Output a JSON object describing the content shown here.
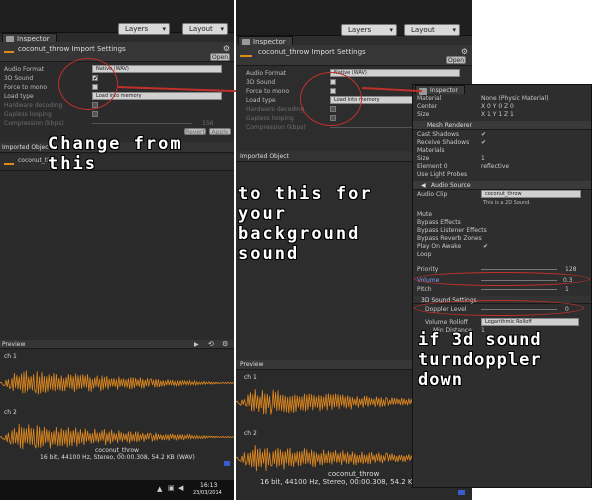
{
  "top_bar": {
    "layers_label": "Layers",
    "layout_label": "Layout",
    "layers_label_2": "Layers",
    "layout_label_2": "Layout"
  },
  "left_panel": {
    "tab": "Inspector",
    "header_title": "coconut_throw Import Settings",
    "open_button": "Open",
    "rows": [
      {
        "label": "Audio Format",
        "value": "Native (WAV)",
        "kind": "dropdown"
      },
      {
        "label": "3D Sound",
        "value": "✔",
        "kind": "check"
      },
      {
        "label": "Force to mono",
        "value": "",
        "kind": "check"
      },
      {
        "label": "Load type",
        "value": "Load into memory",
        "kind": "dropdown"
      },
      {
        "label": "Hardware decoding",
        "value": "",
        "kind": "check_dim"
      },
      {
        "label": "Gapless looping",
        "value": "",
        "kind": "check_dim"
      },
      {
        "label": "Compression (kbps)",
        "value": "156",
        "kind": "slider_dim"
      }
    ],
    "revert_button": "Revert",
    "apply_button": "Apply",
    "imported_object_label": "Imported Objec",
    "imported_object_name": "coconut_th",
    "preview_label": "Preview",
    "ch1": "ch 1",
    "ch2": "ch 2",
    "clip_name": "coconut_throw",
    "clip_info": "16 bit, 44100 Hz, Stereo, 00:00.308, 54.2 KB (WAV)"
  },
  "middle_panel": {
    "tab": "Inspector",
    "header_title": "coconut_throw Import Settings",
    "open_button": "Open",
    "rows": [
      {
        "label": "Audio Format",
        "value": "Native (WAV)",
        "kind": "dropdown"
      },
      {
        "label": "3D Sound",
        "value": "",
        "kind": "check"
      },
      {
        "label": "Force to mono",
        "value": "",
        "kind": "check"
      },
      {
        "label": "Load type",
        "value": "Load into memory",
        "kind": "dropdown"
      },
      {
        "label": "Hardware decoding",
        "value": "",
        "kind": "check_dim"
      },
      {
        "label": "Gapless looping",
        "value": "",
        "kind": "check_dim"
      },
      {
        "label": "Compression (kbps)",
        "value": "",
        "kind": "slider_dim"
      }
    ],
    "imported_object_label": "Imported Object",
    "preview_label": "Preview",
    "ch1": "ch 1",
    "ch2": "ch 2",
    "clip_name": "coconut_throw",
    "clip_info": "16 bit, 44100 Hz, Stereo, 00:00.308, 54.2 KB (WAV)"
  },
  "right_panel": {
    "tab": "Inspector",
    "rows": [
      {
        "label": "Material",
        "value": "None (Physic Material)"
      },
      {
        "label": "Center",
        "value": "X 0      Y 0      Z 0"
      },
      {
        "label": "Size",
        "value": "X 1      Y 1      Z 1"
      }
    ],
    "mesh_renderer": "Mesh Renderer",
    "mesh_rows": [
      {
        "label": "Cast Shadows",
        "value": "✔"
      },
      {
        "label": "Receive Shadows",
        "value": "✔"
      },
      {
        "label": "Materials",
        "value": ""
      },
      {
        "label": "Size",
        "value": "1"
      },
      {
        "label": "Element 0",
        "value": "reflective"
      },
      {
        "label": "Use Light Probes",
        "value": ""
      }
    ],
    "audio_source": "Audio Source",
    "audio_clip_label": "Audio Clip",
    "audio_clip_value": "coconut_throw",
    "audio_clip_note": "This is a 2D Sound.",
    "audio_rows": [
      {
        "label": "Mute",
        "value": ""
      },
      {
        "label": "Bypass Effects",
        "value": ""
      },
      {
        "label": "Bypass Listener Effects",
        "value": ""
      },
      {
        "label": "Bypass Reverb Zones",
        "value": ""
      },
      {
        "label": "Play On Awake",
        "value": "✔"
      },
      {
        "label": "Loop",
        "value": ""
      }
    ],
    "priority_label": "Priority",
    "priority_value": "128",
    "volume_label": "Volume",
    "volume_value": "0.3",
    "pitch_label": "Pitch",
    "pitch_value": "1",
    "settings_3d": "3D Sound Settings",
    "doppler_label": "Doppler Level",
    "doppler_value": "0",
    "rolloff_label": "Volume Rolloff",
    "rolloff_value": "Logarithmic Rolloff",
    "min_distance_label": "Min Distance",
    "min_distance_value": "1"
  },
  "annotations": {
    "change_from": "Change from",
    "this": "this",
    "to_this": "to this for",
    "your": "your",
    "background": "background",
    "sound": "sound",
    "if_3d": "if 3d sound",
    "turn_doppler": "turndoppler",
    "down": "down"
  },
  "taskbar": {
    "time": "16:13",
    "date": "23/03/2014"
  },
  "colors": {
    "panel_bg": "#2b2b2b",
    "waveform": "#e0891e",
    "annotation_red": "#c0302a"
  }
}
